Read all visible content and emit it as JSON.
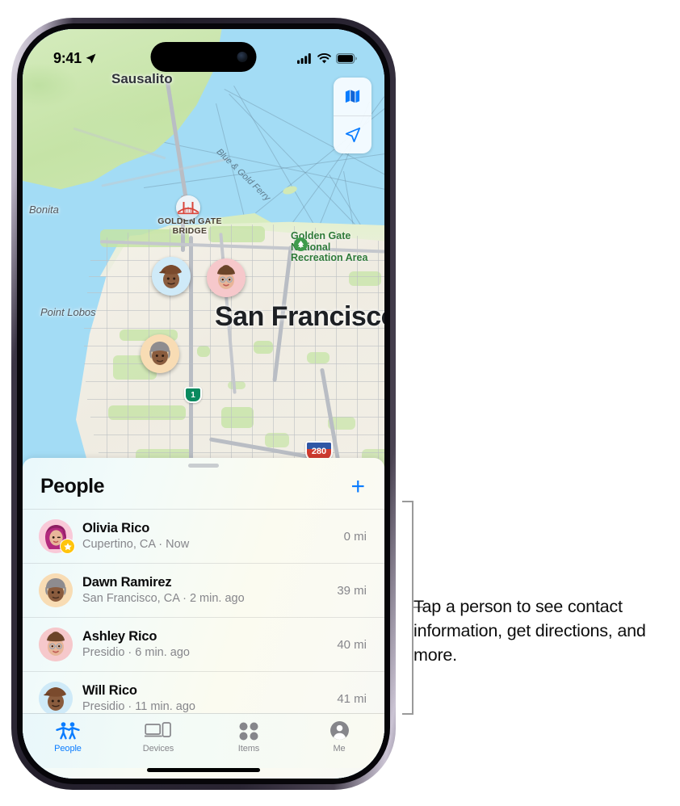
{
  "status_bar": {
    "time": "9:41",
    "location_icon": "location-arrow-icon",
    "cellular_icon": "cellular-signal-icon",
    "wifi_icon": "wifi-icon",
    "battery_icon": "battery-icon"
  },
  "map": {
    "labels": {
      "sausalito": "Sausalito",
      "bonita": "Bonita",
      "point_lobos": "Point Lobos",
      "san_francisco": "San Francisco",
      "ferry": "Blue & Gold Ferry",
      "ggnra": "Golden Gate\nNational\nRecreation Area",
      "golden_gate_bridge": "GOLDEN GATE\nBRIDGE"
    },
    "route_shields": [
      {
        "label": "1",
        "name": "highway-1-shield"
      },
      {
        "label": "280",
        "name": "interstate-280-shield"
      }
    ],
    "controls": [
      {
        "name": "map-type-button",
        "icon": "folded-map-icon"
      },
      {
        "name": "locate-me-button",
        "icon": "location-arrow-icon"
      }
    ],
    "pins": [
      {
        "name": "map-pin-will",
        "person": "Will Rico"
      },
      {
        "name": "map-pin-ashley",
        "person": "Ashley Rico"
      },
      {
        "name": "map-pin-dawn",
        "person": "Dawn Ramirez"
      }
    ]
  },
  "sheet": {
    "title": "People",
    "add_label": "+",
    "people": [
      {
        "name": "Olivia Rico",
        "subtitle": "Cupertino, CA · Now",
        "distance": "0 mi",
        "is_me": true
      },
      {
        "name": "Dawn Ramirez",
        "subtitle": "San Francisco, CA · 2 min. ago",
        "distance": "39 mi",
        "is_me": false
      },
      {
        "name": "Ashley Rico",
        "subtitle": "Presidio · 6 min. ago",
        "distance": "40 mi",
        "is_me": false
      },
      {
        "name": "Will Rico",
        "subtitle": "Presidio · 11 min. ago",
        "distance": "41 mi",
        "is_me": false
      }
    ]
  },
  "tab_bar": {
    "tabs": [
      {
        "label": "People",
        "icon": "people-icon",
        "active": true
      },
      {
        "label": "Devices",
        "icon": "devices-icon",
        "active": false
      },
      {
        "label": "Items",
        "icon": "items-icon",
        "active": false
      },
      {
        "label": "Me",
        "icon": "person-circle-icon",
        "active": false
      }
    ]
  },
  "annotation": {
    "text": "Tap a person to see contact information, get directions, and more."
  },
  "colors": {
    "accent": "#0a7cff",
    "water": "#a3dcf5",
    "land": "#f2efe6",
    "park": "#c6e4a5",
    "secondary_text": "#86868b",
    "star_badge": "#ffc40c"
  }
}
